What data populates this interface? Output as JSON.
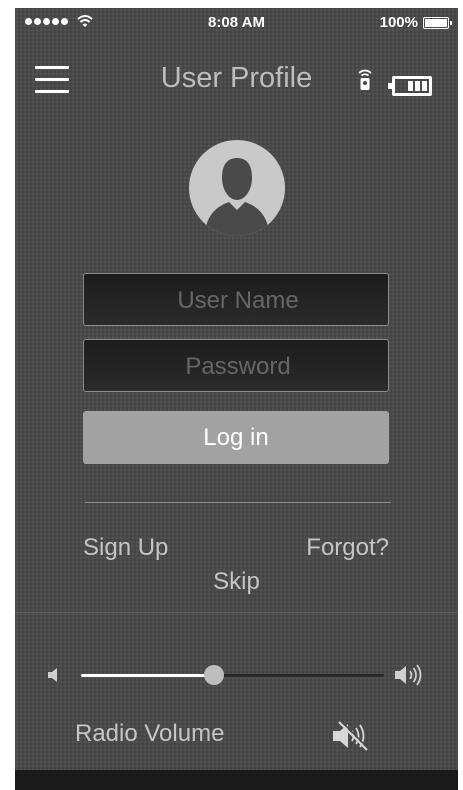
{
  "status_bar": {
    "time": "8:08 AM",
    "battery_percent": "100%",
    "signal_bars": 5
  },
  "header": {
    "title": "User Profile",
    "menu_icon": "hamburger-menu-icon",
    "remote_icon": "remote-control-icon",
    "battery_icon": "battery-level-icon"
  },
  "login": {
    "username_placeholder": "User Name",
    "password_placeholder": "Password",
    "login_label": "Log in",
    "signup_label": "Sign Up",
    "forgot_label": "Forgot?",
    "skip_label": "Skip"
  },
  "volume": {
    "label": "Radio Volume",
    "level": 0.44
  },
  "colors": {
    "background": "#4a4a4a",
    "button": "#a2a2a2",
    "text": "#c5c5c5"
  }
}
